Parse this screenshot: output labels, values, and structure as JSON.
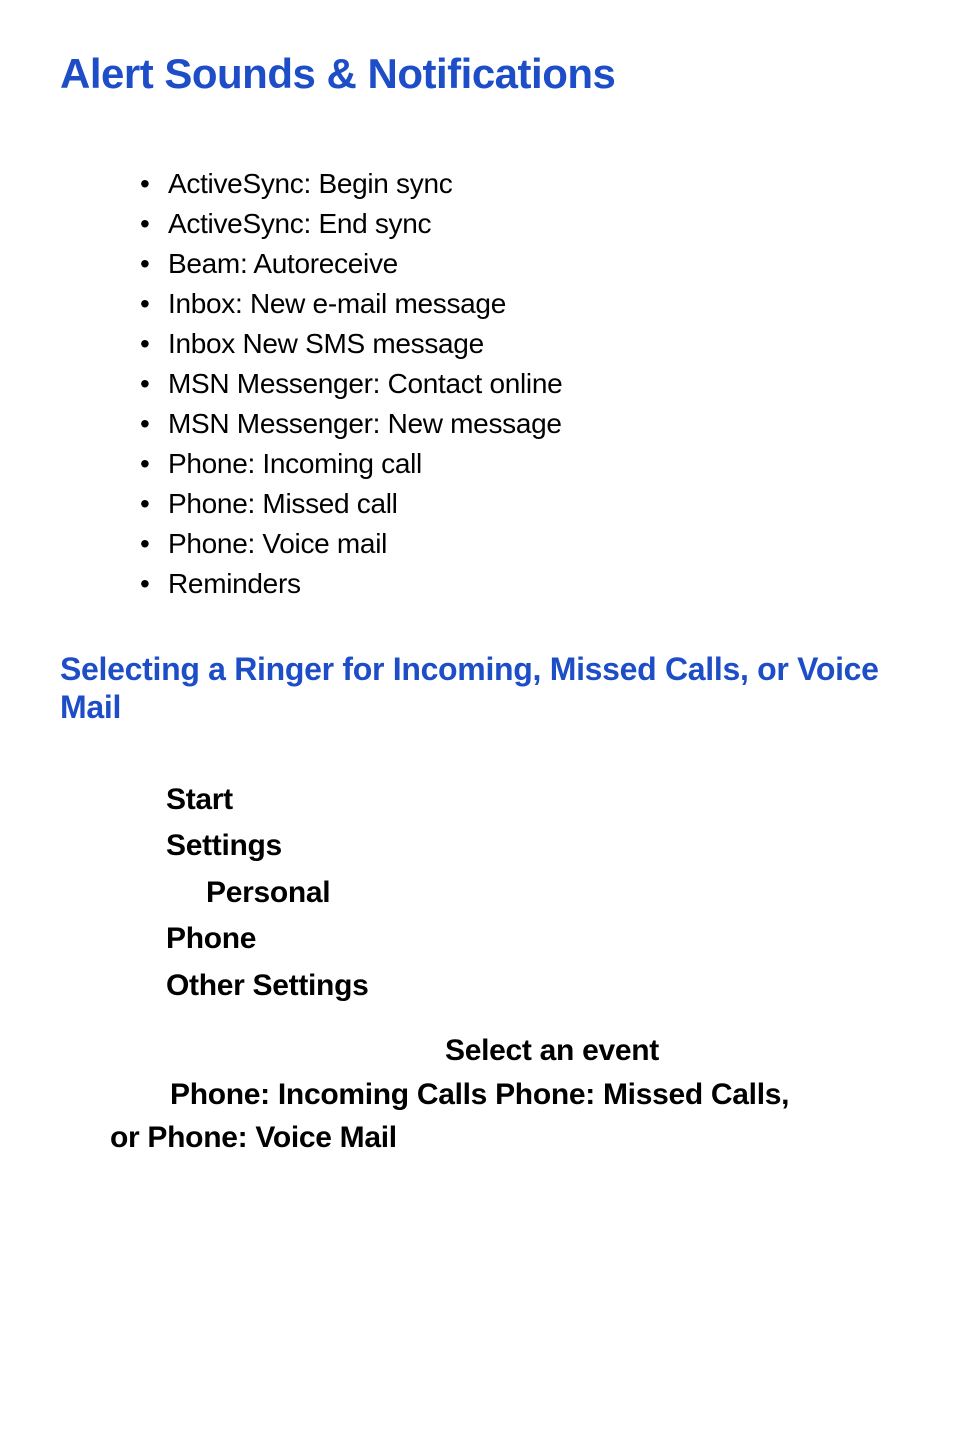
{
  "title": "Alert Sounds & Notifications",
  "bullets": [
    "ActiveSync: Begin sync",
    "ActiveSync: End sync",
    "Beam: Autoreceive",
    "Inbox: New e-mail message",
    "Inbox New SMS message",
    "MSN Messenger: Contact online",
    "MSN Messenger: New message",
    "Phone: Incoming call",
    "Phone: Missed call",
    "Phone: Voice mail",
    "Reminders"
  ],
  "subheading": "Selecting a Ringer for Incoming, Missed Calls, or Voice Mail",
  "steps": {
    "s1": "Start",
    "s2": "Settings",
    "s3": "Personal",
    "s4": "Phone",
    "s5": "Other Settings"
  },
  "final": {
    "line1": "Select an event",
    "line2": "Phone: Incoming Calls  Phone: Missed Calls,",
    "line3": "or Phone: Voice Mail"
  }
}
